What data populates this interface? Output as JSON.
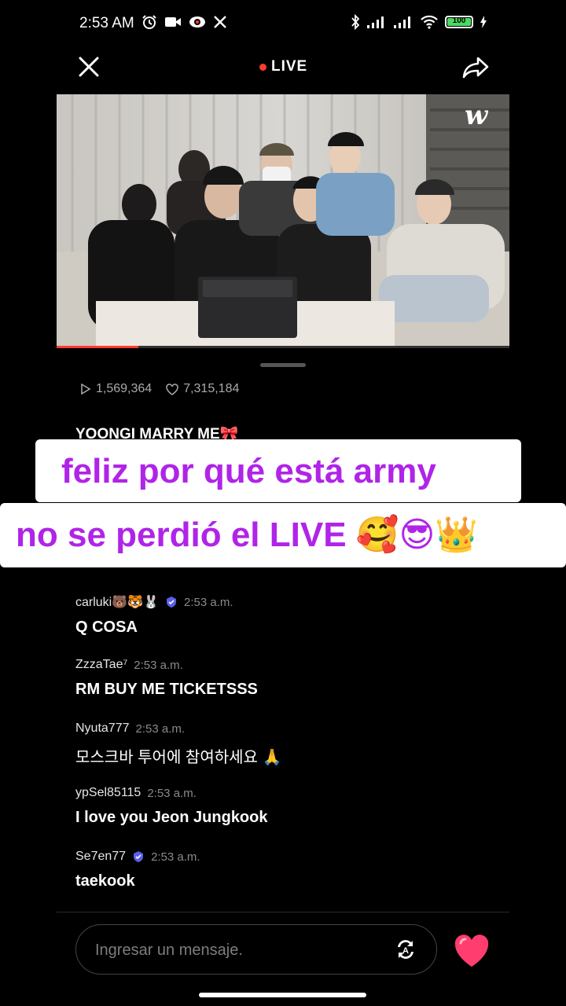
{
  "status_bar": {
    "time": "2:53 AM",
    "battery_level": "100",
    "icons_left": [
      "alarm-icon",
      "video-camera-icon",
      "record-icon",
      "x-logo-icon"
    ],
    "icons_right": [
      "bluetooth-icon",
      "signal-icon",
      "signal-icon",
      "wifi-icon",
      "battery-icon",
      "charging-icon"
    ]
  },
  "header": {
    "live_label": "LIVE",
    "live_color": "#ff3b30"
  },
  "video": {
    "progress": 0.18,
    "watermark": "w"
  },
  "stats": {
    "views": "1,569,364",
    "likes": "7,315,184"
  },
  "comments": {
    "pinned_partial": "YOONGI MARRY ME🎀",
    "partial_emoji_row": "😊😊😊😊😊😊😊😊😊😊😊😊😊😊😊😊😊😊😊",
    "items": [
      {
        "user": "carluki🐻🐯🐰",
        "verified": true,
        "time": "2:53 a.m.",
        "text": "Q COSA"
      },
      {
        "user": "ZzzaTae⁷",
        "verified": false,
        "time": "2:53 a.m.",
        "text": "RM BUY ME TICKETSSS"
      },
      {
        "user": "Nyuta777",
        "verified": false,
        "time": "2:53 a.m.",
        "text": "모스크바 투어에 참여하세요 🙏"
      },
      {
        "user": "ypSel85115",
        "verified": false,
        "time": "2:53 a.m.",
        "text": "I love you Jeon Jungkook"
      },
      {
        "user": "Se7en77",
        "verified": true,
        "time": "2:53 a.m.",
        "text": "taekook"
      }
    ]
  },
  "overlay_caption": {
    "line1": "feliz por qué está  army",
    "line2": "no se perdió el LIVE 🥰😎👑",
    "color": "#b024e8"
  },
  "composer": {
    "placeholder": "Ingresar un mensaje."
  }
}
